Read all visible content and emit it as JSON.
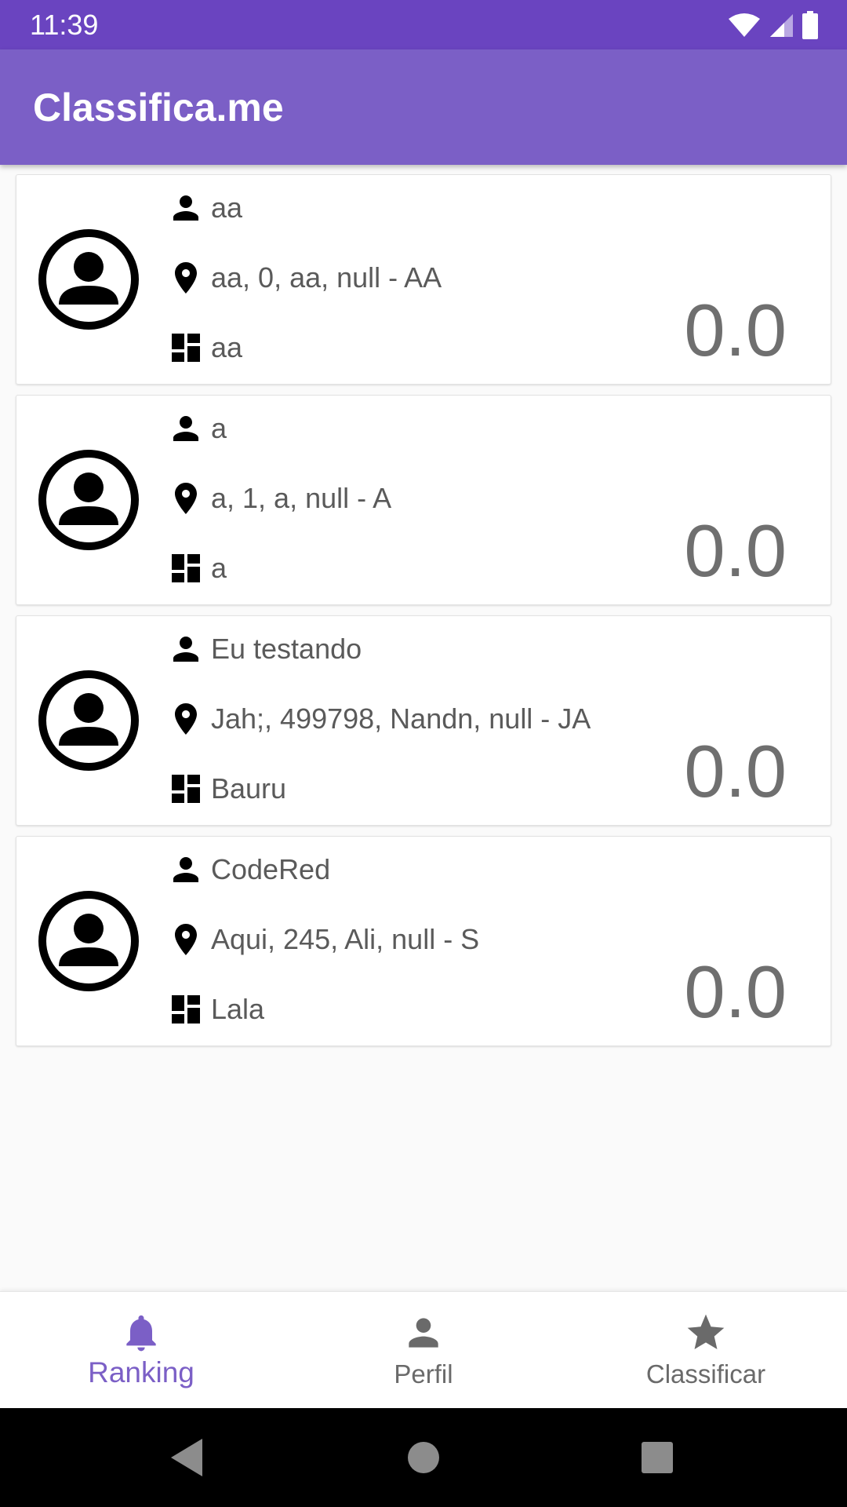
{
  "status_bar": {
    "time": "11:39",
    "icons": [
      "wifi-icon",
      "signal-icon",
      "battery-icon"
    ]
  },
  "app_bar": {
    "title": "Classifica.me"
  },
  "ranking": [
    {
      "name": "aa",
      "address": "aa, 0, aa, null - AA",
      "city": "aa",
      "score": "0.0"
    },
    {
      "name": "a",
      "address": "a, 1, a, null - A",
      "city": "a",
      "score": "0.0"
    },
    {
      "name": "Eu testando",
      "address": "Jah;, 499798, Nandn, null - JA",
      "city": "Bauru",
      "score": "0.0"
    },
    {
      "name": "CodeRed",
      "address": "Aqui, 245, Ali, null - S",
      "city": "Lala",
      "score": "0.0"
    }
  ],
  "bottom_nav": {
    "items": [
      {
        "label": "Ranking",
        "icon": "bell-icon",
        "active": true
      },
      {
        "label": "Perfil",
        "icon": "person-icon",
        "active": false
      },
      {
        "label": "Classificar",
        "icon": "star-icon",
        "active": false
      }
    ]
  },
  "colors": {
    "status_bar": "#6a44c0",
    "app_bar": "#7b5fc6",
    "accent": "#7b5fc6",
    "inactive": "#6a6a6a"
  }
}
